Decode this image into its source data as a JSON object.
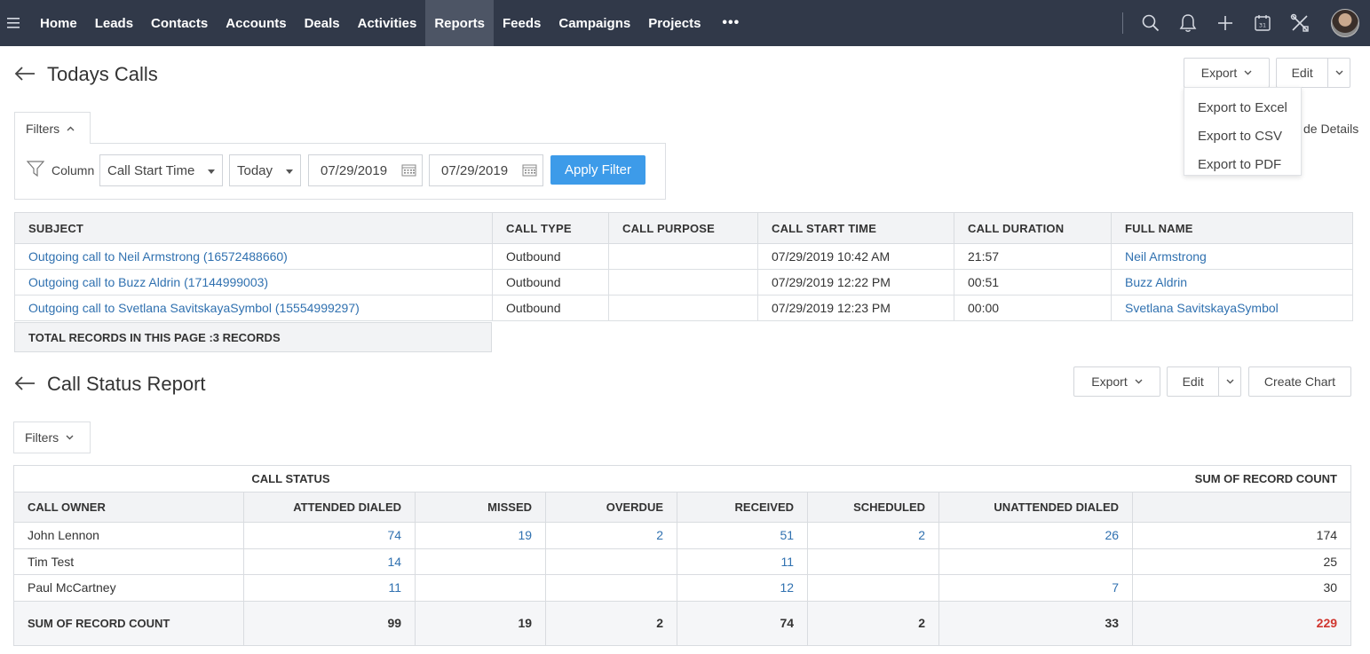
{
  "nav": {
    "items": [
      "Home",
      "Leads",
      "Contacts",
      "Accounts",
      "Deals",
      "Activities",
      "Reports",
      "Feeds",
      "Campaigns",
      "Projects"
    ],
    "active": "Reports",
    "more_label": "•••",
    "calendar_day": "31"
  },
  "report1": {
    "title": "Todays Calls",
    "export_label": "Export",
    "edit_label": "Edit",
    "export_menu": [
      "Export to Excel",
      "Export to CSV",
      "Export to PDF"
    ],
    "hide_details_partial": "de Details",
    "filters": {
      "tab_label": "Filters",
      "column_label": "Column",
      "field_value": "Call Start Time",
      "period_value": "Today",
      "date_from": "07/29/2019",
      "date_to": "07/29/2019",
      "apply_label": "Apply Filter"
    },
    "columns": [
      "SUBJECT",
      "CALL TYPE",
      "CALL PURPOSE",
      "CALL START TIME",
      "CALL DURATION",
      "FULL NAME"
    ],
    "rows": [
      [
        "Outgoing call to Neil Armstrong (16572488660)",
        "Outbound",
        "",
        "07/29/2019 10:42 AM",
        "21:57",
        "Neil Armstrong"
      ],
      [
        "Outgoing call to Buzz Aldrin (17144999003)",
        "Outbound",
        "",
        "07/29/2019 12:22 PM",
        "00:51",
        "Buzz Aldrin"
      ],
      [
        "Outgoing call to Svetlana SavitskayaSymbol (15554999297)",
        "Outbound",
        "",
        "07/29/2019 12:23 PM",
        "00:00",
        "Svetlana SavitskayaSymbol"
      ]
    ],
    "total_records": "TOTAL RECORDS IN THIS PAGE :3 RECORDS"
  },
  "report2": {
    "title": "Call Status Report",
    "export_label": "Export",
    "edit_label": "Edit",
    "create_chart_label": "Create Chart",
    "filters_label": "Filters",
    "group_header": "CALL STATUS",
    "sum_header": "SUM OF RECORD COUNT",
    "owner_header": "CALL OWNER",
    "status_columns": [
      "ATTENDED DIALED",
      "MISSED",
      "OVERDUE",
      "RECEIVED",
      "SCHEDULED",
      "UNATTENDED DIALED"
    ],
    "rows": [
      {
        "owner": "John Lennon",
        "values": [
          "74",
          "19",
          "2",
          "51",
          "2",
          "26"
        ],
        "sum": "174"
      },
      {
        "owner": "Tim Test",
        "values": [
          "14",
          "",
          "",
          "11",
          "",
          ""
        ],
        "sum": "25"
      },
      {
        "owner": "Paul McCartney",
        "values": [
          "11",
          "",
          "",
          "12",
          "",
          "7"
        ],
        "sum": "30"
      }
    ],
    "totals_label": "SUM OF RECORD COUNT",
    "totals": [
      "99",
      "19",
      "2",
      "74",
      "2",
      "33"
    ],
    "grand_total": "229"
  }
}
